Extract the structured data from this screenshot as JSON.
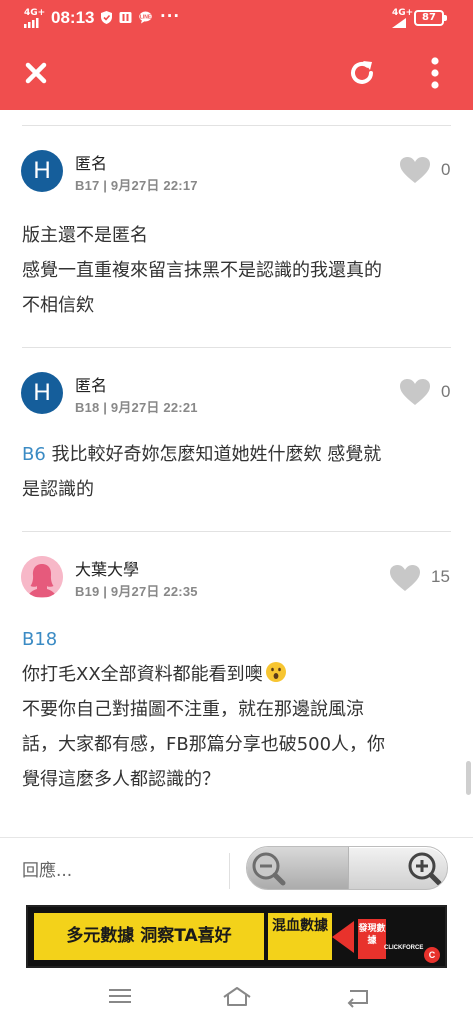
{
  "status_bar": {
    "network_left": "4G+",
    "time": "08:13",
    "more_indicator": "···",
    "network_right": "4G+",
    "battery_level": "87"
  },
  "app_bar": {
    "close_icon": "close-icon",
    "refresh_icon": "refresh-icon",
    "more_icon": "more-vert-icon",
    "background_color": "#f04e4e"
  },
  "comments": [
    {
      "avatar_letter": "H",
      "author": "匿名",
      "floor": "B17",
      "date": "9月27日 22:17",
      "likes": "0",
      "text_lines": [
        "版主還不是匿名",
        "感覺一直重複來留言抹黑不是認識的我還真的",
        "不相信欸"
      ]
    },
    {
      "avatar_letter": "H",
      "author": "匿名",
      "floor": "B18",
      "date": "9月27日 22:21",
      "likes": "0",
      "reply_ref": "B6",
      "text_lines": [
        " 我比較好奇妳怎麼知道她姓什麼欸 感覺就",
        "是認識的"
      ]
    },
    {
      "avatar": "female-silhouette-avatar",
      "author": "大葉大學",
      "floor": "B19",
      "date": "9月27日 22:35",
      "likes": "15",
      "reply_ref": "B18",
      "text_lines": [
        "你打毛XX全部資料都能看到噢",
        "不要你自己對描圖不注重，就在那邊說風涼",
        "話，大家都有感，FB那篇分享也破500人，你",
        "覺得這麼多人都認識的？"
      ]
    }
  ],
  "reply_bar": {
    "placeholder": "回應...",
    "zoom_out_icon": "zoom-out-icon",
    "zoom_in_icon": "zoom-in-icon"
  },
  "ad": {
    "headline": "多元數據 洞察TA喜好",
    "badge": "混血數據",
    "box_text": "發現數據",
    "brand": "CLICKFORCE",
    "logo_letter": "C"
  },
  "nav_bar": {
    "menu_icon": "menu-icon",
    "home_icon": "home-icon",
    "back_icon": "back-icon"
  }
}
